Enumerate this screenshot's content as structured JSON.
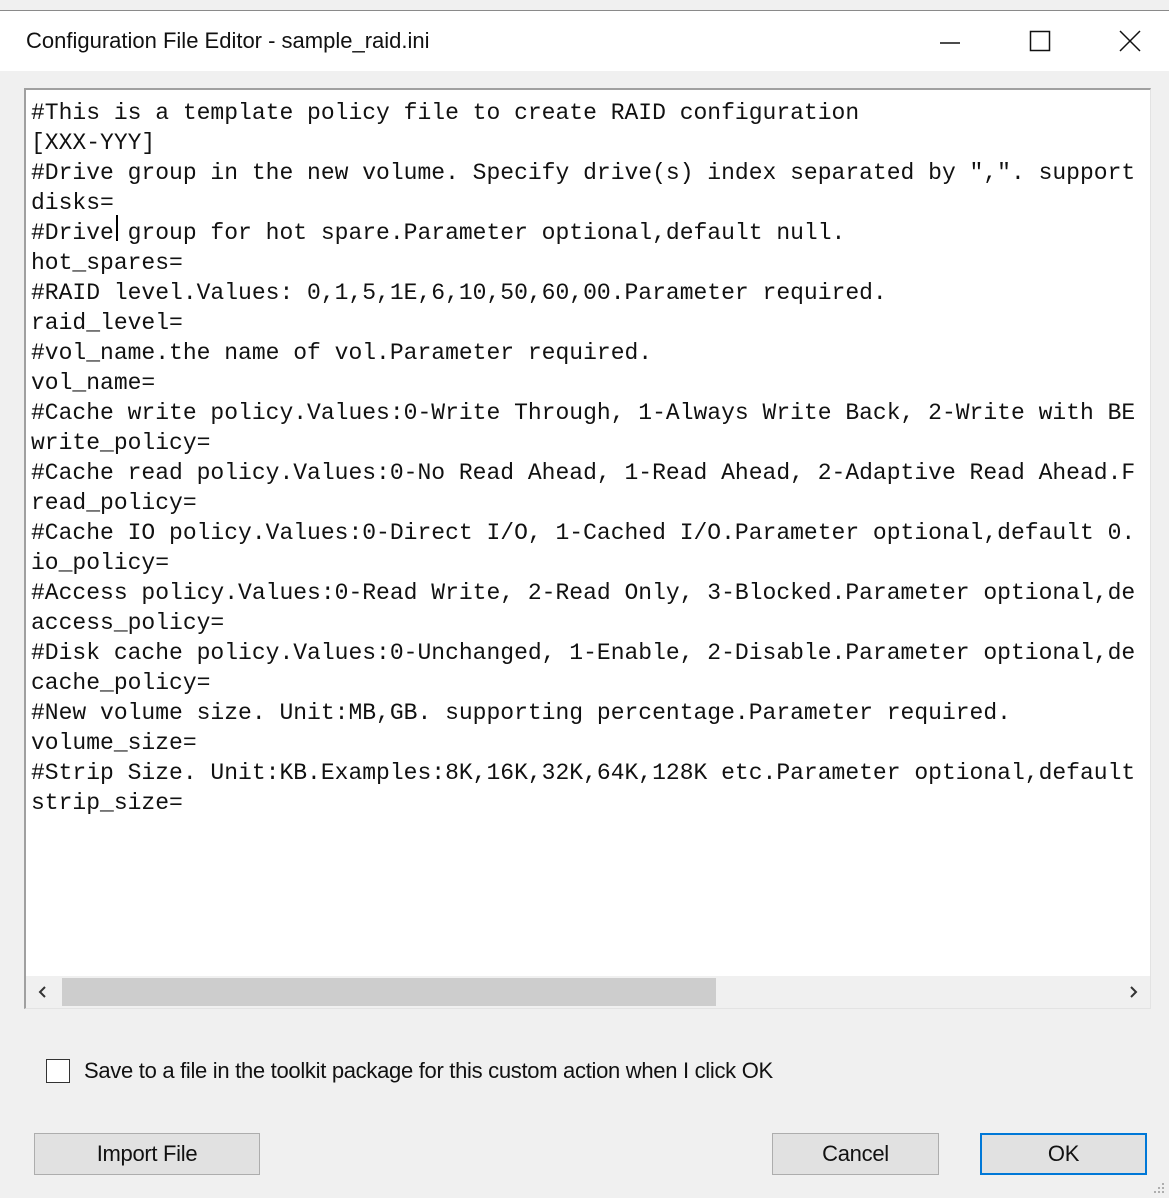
{
  "window": {
    "title": "Configuration File Editor - sample_raid.ini",
    "minimize_icon": "minimize-icon",
    "maximize_icon": "maximize-icon",
    "close_icon": "close-icon"
  },
  "editor": {
    "lines": [
      "#This is a template policy file to create RAID configuration",
      "[XXX-YYY]",
      "#Drive group in the new volume. Specify drive(s) index separated by \",\". support",
      "disks=",
      "#Drive group for hot spare.Parameter optional,default null.",
      "hot_spares=",
      "#RAID level.Values: 0,1,5,1E,6,10,50,60,00.Parameter required.",
      "raid_level=",
      "#vol_name.the name of vol.Parameter required.",
      "vol_name=",
      "#Cache write policy.Values:0-Write Through, 1-Always Write Back, 2-Write with BE",
      "write_policy=",
      "#Cache read policy.Values:0-No Read Ahead, 1-Read Ahead, 2-Adaptive Read Ahead.F",
      "read_policy=",
      "#Cache IO policy.Values:0-Direct I/O, 1-Cached I/O.Parameter optional,default 0.",
      "io_policy=",
      "#Access policy.Values:0-Read Write, 2-Read Only, 3-Blocked.Parameter optional,de",
      "access_policy=",
      "#Disk cache policy.Values:0-Unchanged, 1-Enable, 2-Disable.Parameter optional,de",
      "cache_policy=",
      "#New volume size. Unit:MB,GB. supporting percentage.Parameter required.",
      "volume_size=",
      "#Strip Size. Unit:KB.Examples:8K,16K,32K,64K,128K etc.Parameter optional,default",
      "strip_size="
    ],
    "scroll_left_icon": "chevron-left-icon",
    "scroll_right_icon": "chevron-right-icon",
    "scroll_position_fraction": 0.0
  },
  "options": {
    "save_checkbox_label": "Save to a file in the toolkit package for this custom action when I click OK",
    "save_checkbox_checked": false
  },
  "buttons": {
    "import_label": "Import File",
    "cancel_label": "Cancel",
    "ok_label": "OK"
  }
}
